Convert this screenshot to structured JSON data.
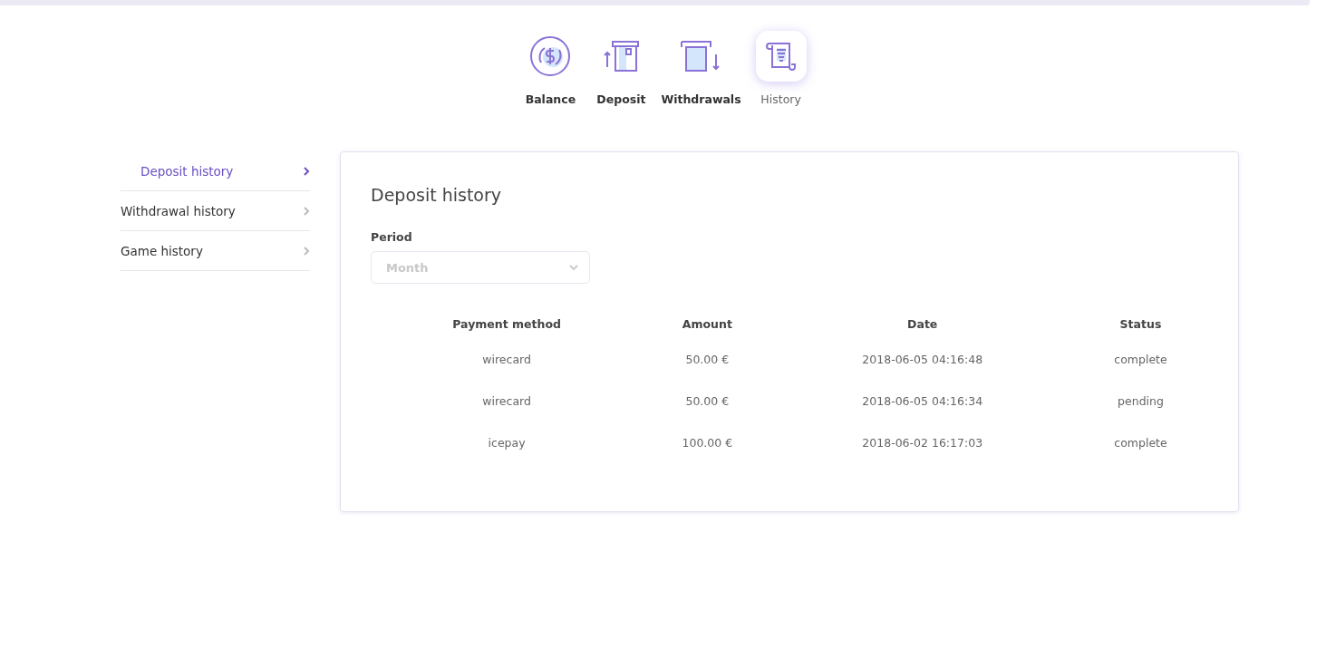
{
  "tabs": [
    {
      "label": "Balance",
      "selected": false
    },
    {
      "label": "Deposit",
      "selected": false
    },
    {
      "label": "Withdrawals",
      "selected": false
    },
    {
      "label": "History",
      "selected": true
    }
  ],
  "sidebar": {
    "items": [
      {
        "label": "Deposit history",
        "selected": true
      },
      {
        "label": "Withdrawal history",
        "selected": false
      },
      {
        "label": "Game history",
        "selected": false
      }
    ]
  },
  "panel": {
    "title": "Deposit history",
    "period": {
      "label": "Period",
      "value": "Month"
    },
    "table": {
      "columns": [
        "Payment method",
        "Amount",
        "Date",
        "Status"
      ],
      "rows": [
        [
          "wirecard",
          "50.00 €",
          "2018-06-05 04:16:48",
          "complete"
        ],
        [
          "wirecard",
          "50.00 €",
          "2018-06-05 04:16:34",
          "pending"
        ],
        [
          "icepay",
          "100.00 €",
          "2018-06-02 16:17:03",
          "complete"
        ]
      ]
    }
  }
}
